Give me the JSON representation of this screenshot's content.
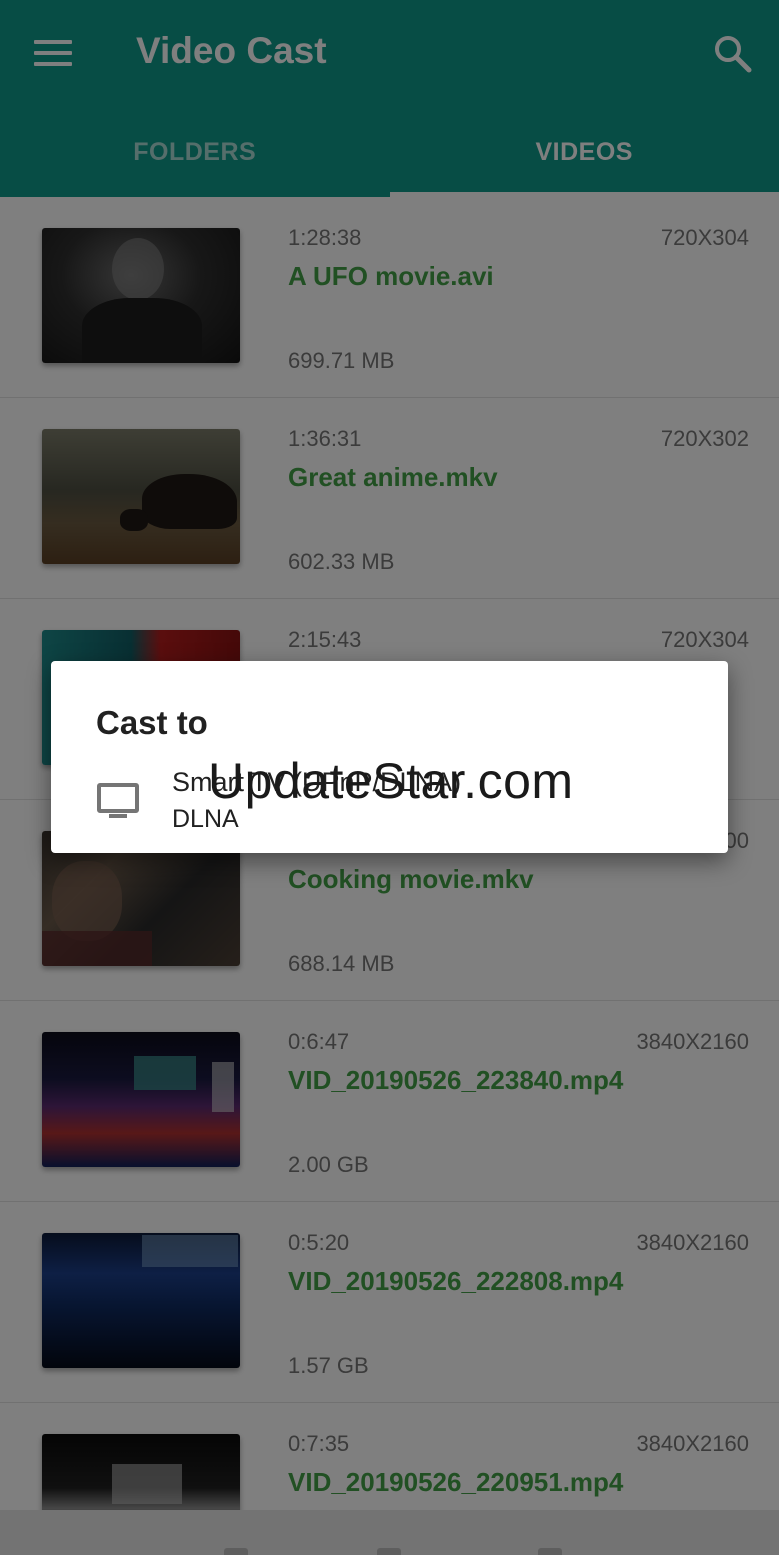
{
  "app_bar": {
    "title": "Video Cast",
    "menu_icon": "hamburger-menu-icon",
    "search_icon": "search-icon",
    "color": "#0f9a8a"
  },
  "tabs": [
    {
      "label": "FOLDERS",
      "active": false
    },
    {
      "label": "VIDEOS",
      "active": true
    }
  ],
  "videos": [
    {
      "duration": "1:28:38",
      "resolution": "720X304",
      "name": "A UFO movie.avi",
      "size": "699.71 MB"
    },
    {
      "duration": "1:36:31",
      "resolution": "720X302",
      "name": "Great anime.mkv",
      "size": "602.33 MB"
    },
    {
      "duration": "2:15:43",
      "resolution": "720X304",
      "name": "",
      "size": ""
    },
    {
      "duration": "",
      "resolution": "00",
      "name": "Cooking movie.mkv",
      "size": "688.14 MB"
    },
    {
      "duration": "0:6:47",
      "resolution": "3840X2160",
      "name": "VID_20190526_223840.mp4",
      "size": "2.00 GB"
    },
    {
      "duration": "0:5:20",
      "resolution": "3840X2160",
      "name": "VID_20190526_222808.mp4",
      "size": "1.57 GB"
    },
    {
      "duration": "0:7:35",
      "resolution": "3840X2160",
      "name": "VID_20190526_220951.mp4",
      "size": ""
    }
  ],
  "cast_dialog": {
    "title": "Cast to",
    "devices": [
      {
        "name": "Smart TV (UPnP/DLNA)",
        "type": "DLNA",
        "icon": "tv-icon"
      }
    ]
  },
  "watermark": "UpdateStar.com",
  "colors": {
    "accent": "#0f9a8a",
    "filename_green": "#43a047",
    "meta_gray": "#777777"
  }
}
